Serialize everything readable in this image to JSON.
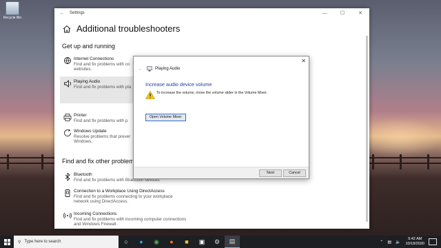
{
  "desktop": {
    "recycle_bin_label": "Recycle Bin"
  },
  "settings": {
    "window_title": "Settings",
    "page_title": "Additional troubleshooters",
    "sections": [
      {
        "title": "Get up and running"
      },
      {
        "title": "Find and fix other problems"
      }
    ],
    "items": [
      {
        "name": "Internet Connections",
        "desc": "Find and fix problems with co",
        "desc2": "websites."
      },
      {
        "name": "Playing Audio",
        "desc": "Find and fix problems with pla",
        "desc2": ""
      },
      {
        "name": "Printer",
        "desc": "Find and fix problems with p",
        "desc2": ""
      },
      {
        "name": "Windows Update",
        "desc": "Resolve problems that prever",
        "desc2": "Windows."
      },
      {
        "name": "Bluetooth",
        "desc": "Find and fix problems with Bluetooth devices",
        "desc2": ""
      },
      {
        "name": "Connection to a Workplace Using DirectAccess",
        "desc": "Find and fix problems connecting to your workplace",
        "desc2": "network using DirectAccess."
      },
      {
        "name": "Incoming Connections",
        "desc": "Find and fix problems with incoming computer connections",
        "desc2": "and Windows Firewall."
      }
    ]
  },
  "dialog": {
    "title": "Playing Audio",
    "heading": "Increase audio device volume",
    "message": "To increase the volume, move the volume slider in the Volume Mixer.",
    "open_mixer_label": "Open Volume Mixer",
    "next_label": "Next",
    "cancel_label": "Cancel"
  },
  "taskbar": {
    "search_placeholder": "Type here to search",
    "time": "9:42 AM",
    "date": "10/18/2020"
  }
}
